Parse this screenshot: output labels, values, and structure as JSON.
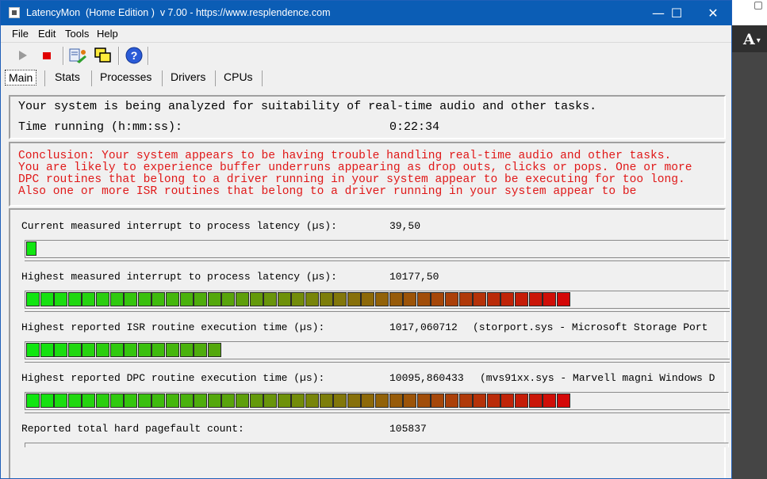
{
  "window": {
    "title": "LatencyMon  (Home Edition )  v 7.00 - https://www.resplendence.com",
    "controls": {
      "minimize": "—",
      "maximize": "☐",
      "close": "✕"
    }
  },
  "background": {
    "letter": "A"
  },
  "menu": [
    "File",
    "Edit",
    "Tools",
    "Help"
  ],
  "toolbar": [
    "play-icon",
    "stop-icon",
    "report-icon",
    "windows-icon",
    "help-icon"
  ],
  "tabs": [
    "Main",
    "Stats",
    "Processes",
    "Drivers",
    "CPUs"
  ],
  "status": {
    "analyzing": "Your system is being analyzed for suitability of real-time audio and other tasks.",
    "time_label": "Time running (h:mm:ss):",
    "time_value": "0:22:34"
  },
  "conclusion": [
    "Conclusion: Your system appears to be having trouble handling real-time audio and other tasks.",
    "You are likely to experience buffer underruns appearing as drop outs, clicks or pops. One or more",
    "DPC routines that belong to a driver running in your system appear to be executing for too long.",
    "Also one or more ISR routines that belong to a driver running in your system appear to be"
  ],
  "metrics": [
    {
      "label": "Current measured interrupt to process latency (µs):",
      "value": "39,50",
      "detail": "",
      "segments": 1
    },
    {
      "label": "Highest measured interrupt to process latency (µs):",
      "value": "10177,50",
      "detail": "",
      "segments": 39
    },
    {
      "label": "Highest reported ISR routine execution time (µs):",
      "value": "1017,060712",
      "detail": "(storport.sys - Microsoft Storage Port",
      "segments": 14
    },
    {
      "label": "Highest reported DPC routine execution time (µs):",
      "value": "10095,860433",
      "detail": "(mvs91xx.sys - Marvell magni Windows D",
      "segments": 39
    },
    {
      "label": "Reported total hard pagefault count:",
      "value": "105837",
      "detail": "",
      "segments": 0
    }
  ],
  "colors": {
    "title_bar": "#0b5db5",
    "conclusion_text": "#e01818",
    "meter_start": "#11e611",
    "meter_end": "#d40808"
  }
}
